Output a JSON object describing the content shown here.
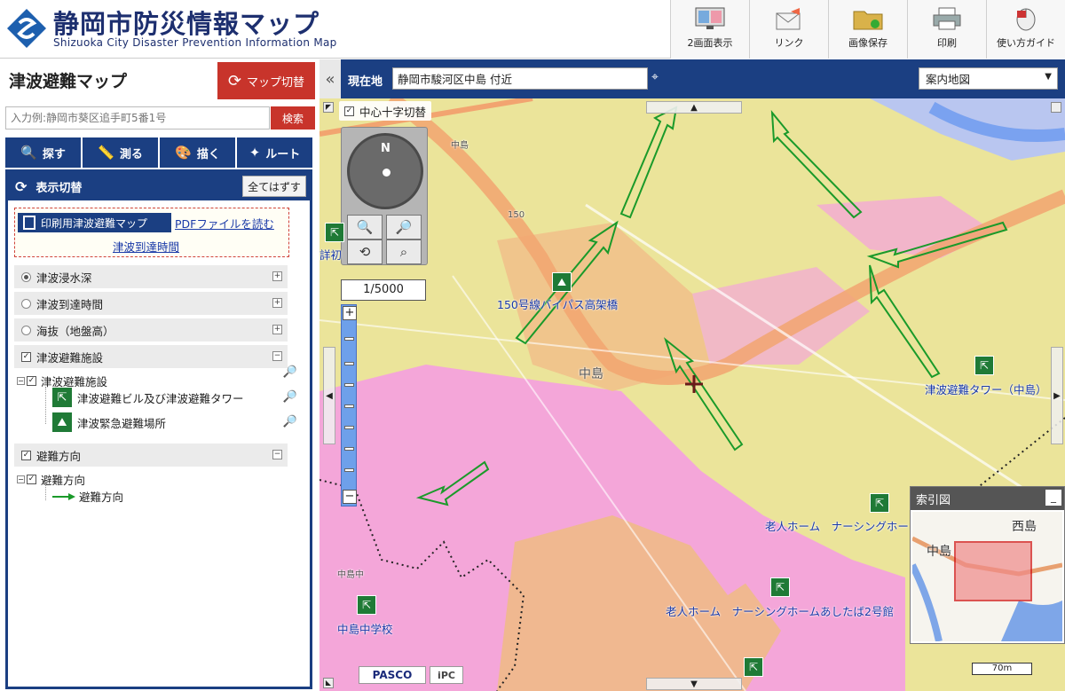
{
  "header": {
    "title": "静岡市防災情報マップ",
    "subtitle": "Shizuoka City Disaster Prevention Information Map",
    "toolbar": [
      {
        "label": "2画面表示",
        "icon": "dual-screen-icon"
      },
      {
        "label": "リンク",
        "icon": "link-mail-icon"
      },
      {
        "label": "画像保存",
        "icon": "save-image-folder-icon"
      },
      {
        "label": "印刷",
        "icon": "printer-icon"
      },
      {
        "label": "使い方ガイド",
        "icon": "mouse-guide-icon"
      }
    ]
  },
  "left": {
    "title": "津波避難マップ",
    "switch_label": "マップ切替",
    "search": {
      "placeholder": "入力例:静岡市葵区追手町5番1号",
      "button": "検索"
    },
    "tabs": [
      "探す",
      "測る",
      "描く",
      "ルート"
    ],
    "display": {
      "header": "表示切替",
      "clear_all": "全てはずす",
      "print_button": "印刷用津波避難マップ",
      "pdf_link": "PDFファイルを読む",
      "arrival_link": "津波到達時間",
      "layers": [
        {
          "label": "津波浸水深",
          "type": "radio",
          "checked": true
        },
        {
          "label": "津波到達時間",
          "type": "radio",
          "checked": false
        },
        {
          "label": "海抜（地盤高）",
          "type": "radio",
          "checked": false
        },
        {
          "label": "津波避難施設",
          "type": "checkbox",
          "checked": true
        },
        {
          "label": "避難方向",
          "type": "checkbox",
          "checked": true
        }
      ],
      "facility_tree": {
        "group": "津波避難施設",
        "items": [
          "津波避難ビル及び津波避難タワー",
          "津波緊急避難場所"
        ]
      },
      "direction_tree": {
        "group": "避難方向",
        "items": [
          "避難方向"
        ]
      }
    }
  },
  "mapbar": {
    "location_label": "現在地",
    "location_value": "静岡市駿河区中島 付近",
    "basemap": "案内地図"
  },
  "map": {
    "cross_toggle": "中心十字切替",
    "compass_label": "N",
    "scale": "1/5000",
    "labels": {
      "bridge": "150号線バイパス高架橋",
      "nakajima": "中島",
      "tower": "津波避難タワー（中島）",
      "home1": "老人ホーム　ナーシングホー",
      "home2": "老人ホーム　ナーシングホームあしたば2号館",
      "school": "中島中学校",
      "nakajima_chu": "中島中",
      "nishijima_hint": "中島",
      "route": "150",
      "left_cut": "詳初"
    },
    "index_map": {
      "title": "索引図",
      "label_west": "西島",
      "label_naka": "中島"
    },
    "logos": [
      "PASCO",
      "iPC"
    ],
    "scale_bar": "70m"
  }
}
